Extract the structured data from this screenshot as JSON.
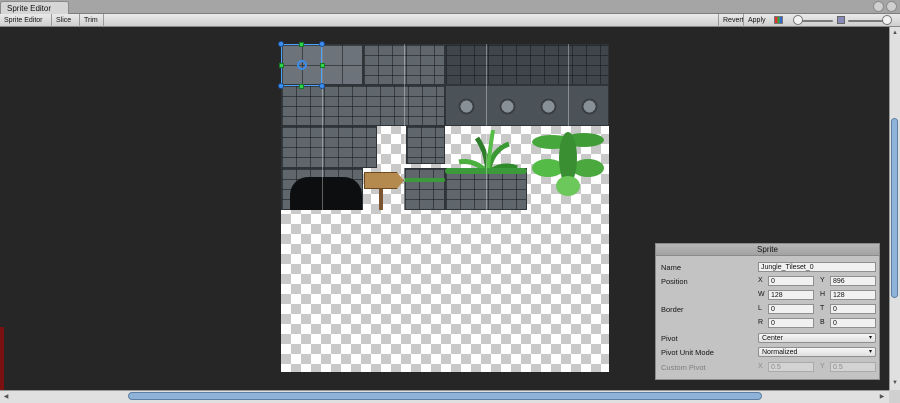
{
  "window": {
    "tab_title": "Sprite Editor"
  },
  "toolbar": {
    "mode_label": "Sprite Editor ↕",
    "slice_label": "Slice ↕",
    "trim_label": "Trim",
    "revert_label": "Revert",
    "apply_label": "Apply"
  },
  "icons": {
    "color_channels": "rgb-channels-icon",
    "zoom_min": "zoom-out-icon",
    "mip_toggle": "mip-level-icon"
  },
  "sprite_panel": {
    "title": "Sprite",
    "name_label": "Name",
    "name_value": "Jungle_Tileset_0",
    "position_label": "Position",
    "x_axis": "X",
    "x_value": "0",
    "y_axis": "Y",
    "y_value": "896",
    "w_axis": "W",
    "w_value": "128",
    "h_axis": "H",
    "h_value": "128",
    "border_label": "Border",
    "l_axis": "L",
    "l_value": "0",
    "t_axis": "T",
    "t_value": "0",
    "r_axis": "R",
    "r_value": "0",
    "b_axis": "B",
    "b_value": "0",
    "pivot_label": "Pivot",
    "pivot_value": "Center",
    "pivot_unit_label": "Pivot Unit Mode",
    "pivot_unit_value": "Normalized",
    "custom_pivot_label": "Custom Pivot",
    "cx_axis": "X",
    "cx_value": "0.5",
    "cy_axis": "Y",
    "cy_value": "0.5"
  },
  "colors": {
    "selection_outline": "#4aa3ff",
    "handle_corner": "#3b8ef0",
    "handle_edge": "#2fd24a",
    "scroll_thumb": "#8fb3d8"
  }
}
